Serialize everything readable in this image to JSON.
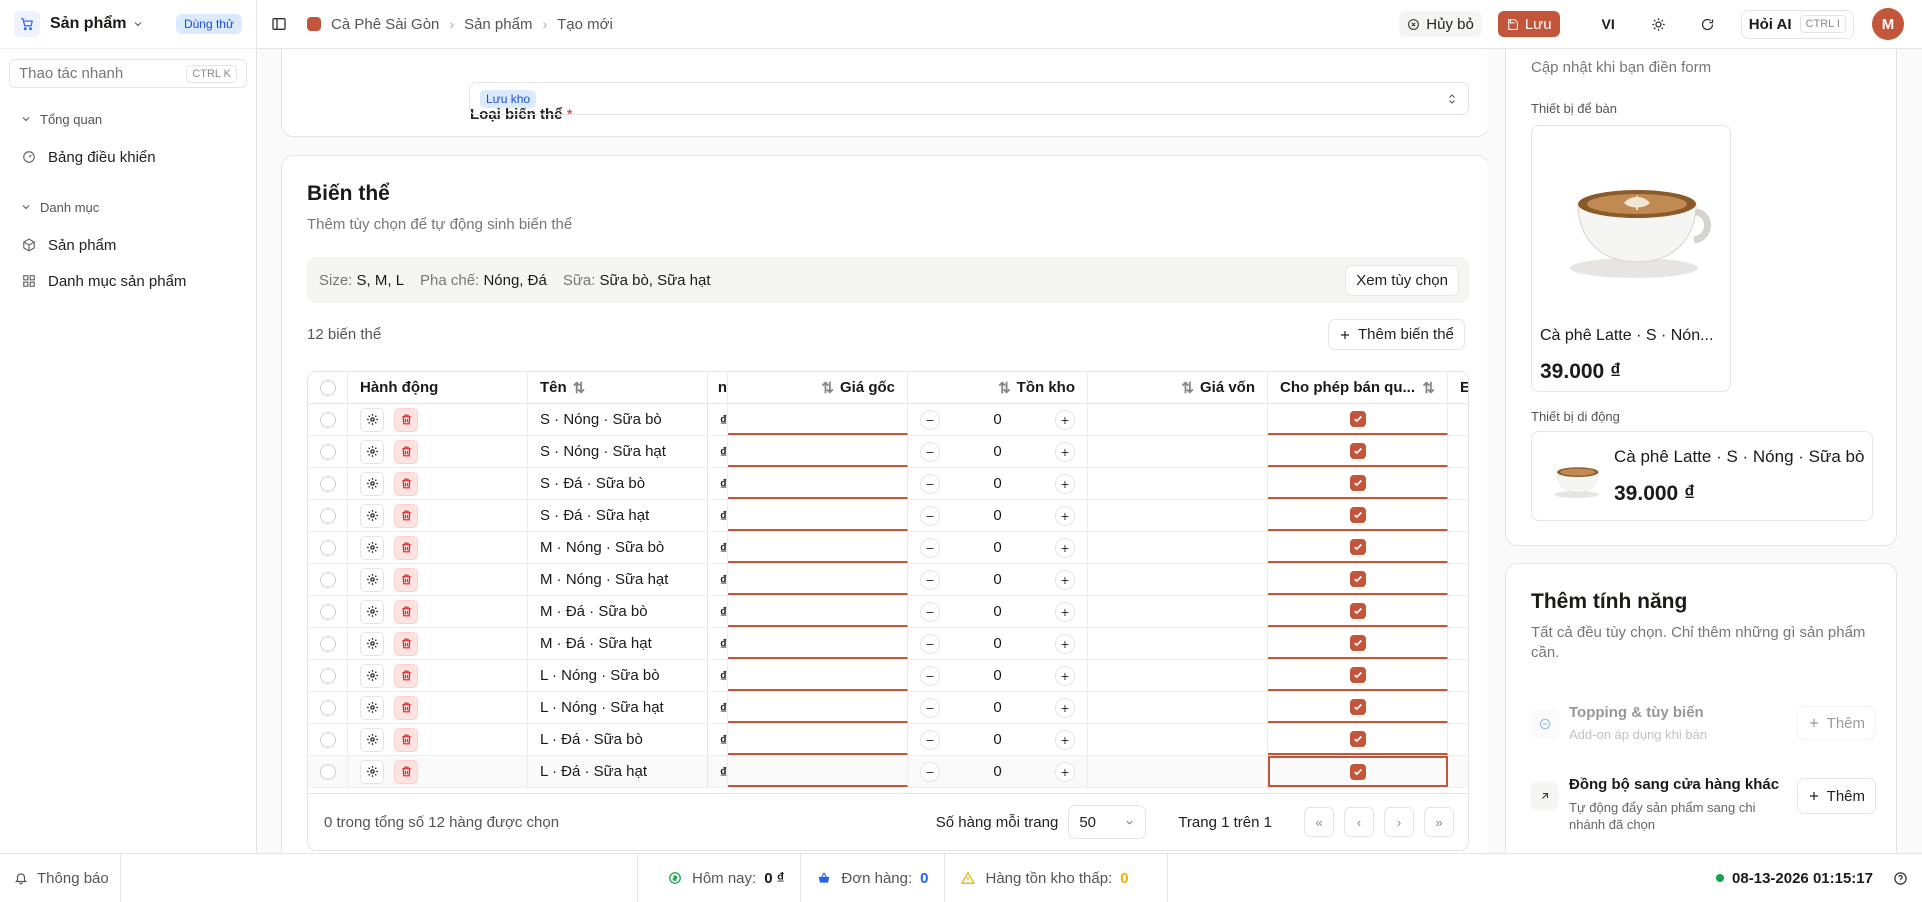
{
  "sidebar": {
    "app_name": "Sản phẩm",
    "trial_badge": "Dùng thử",
    "quick_placeholder": "Thao tác nhanh",
    "quick_shortcut": "CTRL K",
    "groups": [
      {
        "label": "Tổng quan",
        "items": [
          {
            "label": "Bảng điều khiển",
            "icon": "gauge-icon"
          }
        ]
      },
      {
        "label": "Danh mục",
        "items": [
          {
            "label": "Sản phẩm",
            "icon": "box-icon"
          },
          {
            "label": "Danh mục sản phẩm",
            "icon": "grid-icon"
          }
        ]
      }
    ]
  },
  "topbar": {
    "breadcrumb": [
      "Cà Phê Sài Gòn",
      "Sản phẩm",
      "Tạo mới"
    ],
    "cancel_label": "Hủy bỏ",
    "save_label": "Lưu",
    "lang": "VI",
    "ai_label": "Hỏi AI",
    "ai_shortcut": "CTRL I",
    "avatar": "M"
  },
  "variant_type": {
    "label": "Loại biến thể",
    "required_mark": "*",
    "value": "Lưu kho"
  },
  "variants": {
    "title": "Biến thể",
    "subtitle": "Thêm tùy chọn để tự động sinh biến thể",
    "options": [
      {
        "key": "Size:",
        "values": "S, M, L"
      },
      {
        "key": "Pha chế:",
        "values": "Nóng, Đá"
      },
      {
        "key": "Sữa:",
        "values": "Sữa bò, Sữa hạt"
      }
    ],
    "view_options_label": "Xem tùy chọn",
    "count_label": "12 biến thể",
    "add_variant_label": "Thêm biến thể",
    "columns": {
      "action": "Hành động",
      "name": "Tên",
      "price_partial": "n",
      "base_price": "Giá gốc",
      "stock": "Tồn kho",
      "cost": "Giá vốn",
      "oversell": "Cho phép bán qu...",
      "next_partial": "E"
    },
    "rows": [
      {
        "name": "S · Nóng · Sữa bò",
        "price": "₫",
        "stock": "0",
        "oversell": true
      },
      {
        "name": "S · Nóng · Sữa hạt",
        "price": "₫",
        "stock": "0",
        "oversell": true
      },
      {
        "name": "S · Đá · Sữa bò",
        "price": "₫",
        "stock": "0",
        "oversell": true
      },
      {
        "name": "S · Đá · Sữa hạt",
        "price": "₫",
        "stock": "0",
        "oversell": true
      },
      {
        "name": "M · Nóng · Sữa bò",
        "price": "₫",
        "stock": "0",
        "oversell": true
      },
      {
        "name": "M · Nóng · Sữa hạt",
        "price": "₫",
        "stock": "0",
        "oversell": true
      },
      {
        "name": "M · Đá · Sữa bò",
        "price": "₫",
        "stock": "0",
        "oversell": true
      },
      {
        "name": "M · Đá · Sữa hạt",
        "price": "₫",
        "stock": "0",
        "oversell": true
      },
      {
        "name": "L · Nóng · Sữa bò",
        "price": "₫",
        "stock": "0",
        "oversell": true
      },
      {
        "name": "L · Nóng · Sữa hạt",
        "price": "₫",
        "stock": "0",
        "oversell": true
      },
      {
        "name": "L · Đá · Sữa bò",
        "price": "₫",
        "stock": "0",
        "oversell": true
      },
      {
        "name": "L · Đá · Sữa hạt",
        "price": "₫",
        "stock": "0",
        "oversell": true
      }
    ],
    "pager": {
      "selected": "0 trong tổng số 12 hàng được chọn",
      "rows_per_page_label": "Số hàng mỗi trang",
      "rows_per_page": "50",
      "page": "Trang 1 trên 1"
    }
  },
  "preview": {
    "subtitle": "Cập nhật khi bạn điền form",
    "desktop_label": "Thiết bị để bàn",
    "product_name_short": "Cà phê Latte · S · Nón...",
    "product_name": "Cà phê Latte · S · Nóng · Sữa bò",
    "price": "39.000 ₫",
    "mobile_label": "Thiết bị di động"
  },
  "features": {
    "title": "Thêm tính năng",
    "subtitle": "Tất cả đều tùy chọn. Chỉ thêm những gì sản phẩm cần.",
    "items": [
      {
        "title": "Topping & tùy biến",
        "desc": "Add-on áp dụng khi bán",
        "button": "Thêm",
        "disabled": true
      },
      {
        "title": "Đồng bộ sang cửa hàng khác",
        "desc": "Tự động đẩy sản phẩm sang chi nhánh đã chọn",
        "button": "Thêm",
        "disabled": false
      }
    ]
  },
  "statusbar": {
    "notifications": "Thông báo",
    "today_label": "Hôm nay:",
    "today_value": "0 ₫",
    "orders_label": "Đơn hàng:",
    "orders_value": "0",
    "low_stock_label": "Hàng tồn kho thấp:",
    "low_stock_value": "0",
    "datetime": "08-13-2026 01:15:17"
  },
  "colors": {
    "accent": "#c2553a",
    "info": "#2563eb",
    "success": "#16a34a",
    "warning": "#eab308"
  }
}
